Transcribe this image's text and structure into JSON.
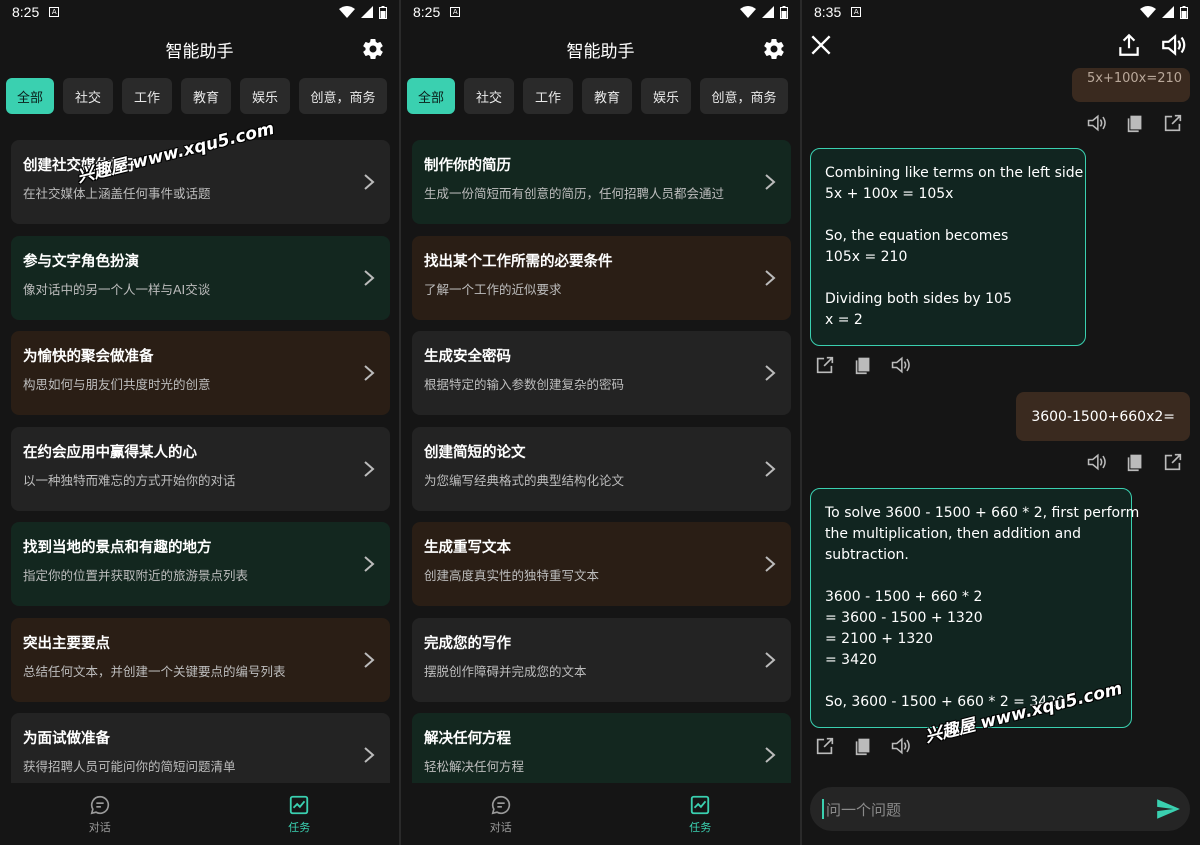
{
  "status_left": {
    "time": "8:25"
  },
  "status_mid": {
    "time": "8:25"
  },
  "status_right": {
    "time": "8:35"
  },
  "app_title": "智能助手",
  "chips": [
    {
      "label": "全部",
      "active": true
    },
    {
      "label": "社交"
    },
    {
      "label": "工作"
    },
    {
      "label": "教育"
    },
    {
      "label": "娱乐"
    },
    {
      "label": "创意，商务"
    }
  ],
  "panel1_cards": [
    {
      "title": "创建社交媒体帖子",
      "subtitle": "在社交媒体上涵盖任何事件或话题",
      "tone": "gray"
    },
    {
      "title": "参与文字角色扮演",
      "subtitle": "像对话中的另一个人一样与AI交谈",
      "tone": "green"
    },
    {
      "title": "为愉快的聚会做准备",
      "subtitle": "构思如何与朋友们共度时光的创意",
      "tone": "brown"
    },
    {
      "title": "在约会应用中赢得某人的心",
      "subtitle": "以一种独特而难忘的方式开始你的对话",
      "tone": "gray"
    },
    {
      "title": "找到当地的景点和有趣的地方",
      "subtitle": "指定你的位置并获取附近的旅游景点列表",
      "tone": "green"
    },
    {
      "title": "突出主要要点",
      "subtitle": "总结任何文本，并创建一个关键要点的编号列表",
      "tone": "brown"
    },
    {
      "title": "为面试做准备",
      "subtitle": "获得招聘人员可能问你的简短问题清单",
      "tone": "gray"
    }
  ],
  "panel2_cards": [
    {
      "title": "制作你的简历",
      "subtitle": "生成一份简短而有创意的简历，任何招聘人员都会通过",
      "tone": "green"
    },
    {
      "title": "找出某个工作所需的必要条件",
      "subtitle": "了解一个工作的近似要求",
      "tone": "brown"
    },
    {
      "title": "生成安全密码",
      "subtitle": "根据特定的输入参数创建复杂的密码",
      "tone": "gray"
    },
    {
      "title": "创建简短的论文",
      "subtitle": "为您编写经典格式的典型结构化论文",
      "tone": "gray"
    },
    {
      "title": "生成重写文本",
      "subtitle": "创建高度真实性的独特重写文本",
      "tone": "brown"
    },
    {
      "title": "完成您的写作",
      "subtitle": "摆脱创作障碍并完成您的文本",
      "tone": "gray"
    },
    {
      "title": "解决任何方程",
      "subtitle": "轻松解决任何方程",
      "tone": "green"
    }
  ],
  "nav": {
    "chat_label": "对话",
    "tasks_label": "任务"
  },
  "chat": {
    "partial_user_msg": "5x+100x=210",
    "ai_msg_1": [
      "Combining like terms on the left side",
      "5x + 100x = 105x",
      "",
      "So, the equation becomes",
      "105x = 210",
      "",
      "Dividing both sides by 105",
      "x = 2"
    ],
    "user_msg_2": "3600-1500+660x2=",
    "ai_msg_2": [
      "To solve 3600 - 1500 + 660 * 2, first perform",
      "the multiplication, then addition and",
      "subtraction.",
      "",
      "3600 - 1500 + 660 * 2",
      "= 3600 - 1500 + 1320",
      "= 2100 + 1320",
      "= 3420",
      "",
      "So, 3600 - 1500 + 660 * 2 = 3420"
    ],
    "input_placeholder": "问一个问题"
  },
  "watermark": "兴趣屋 www.xqu5.com",
  "colors": {
    "accent": "#3ad0b0",
    "bg": "#151515",
    "card_gray": "#232323",
    "card_green": "#13271f",
    "card_brown": "#2a1e15",
    "user_bubble": "#3a2a1f"
  }
}
